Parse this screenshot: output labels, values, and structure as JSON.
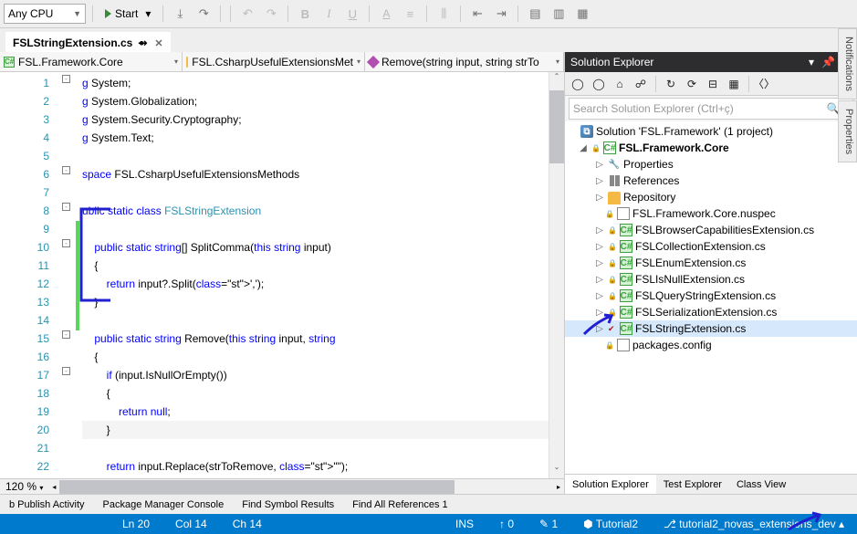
{
  "toolbar": {
    "platform": "Any CPU",
    "start": "Start"
  },
  "tab": {
    "filename": "FSLStringExtension.cs",
    "pin": "⊕"
  },
  "nav": {
    "ns": "FSL.Framework.Core",
    "cls": "FSL.CsharpUsefulExtensionsMet",
    "method": "Remove(string input, string strTo"
  },
  "code": {
    "lines": [
      {
        "n": "1",
        "t": "g System;"
      },
      {
        "n": "2",
        "t": "g System.Globalization;"
      },
      {
        "n": "3",
        "t": "g System.Security.Cryptography;"
      },
      {
        "n": "4",
        "t": "g System.Text;"
      },
      {
        "n": "5",
        "t": ""
      },
      {
        "n": "6",
        "t": "space FSL.CsharpUsefulExtensionsMethods"
      },
      {
        "n": "7",
        "t": ""
      },
      {
        "n": "8",
        "t": "ublic static class FSLStringExtension",
        "kw": "ublic static class",
        "tp": "FSLStringExtension"
      },
      {
        "n": "9",
        "t": ""
      },
      {
        "n": "10",
        "t": "    public static string[] SplitComma(this string input)"
      },
      {
        "n": "11",
        "t": "    {"
      },
      {
        "n": "12",
        "t": "        return input?.Split(',');"
      },
      {
        "n": "13",
        "t": "    }"
      },
      {
        "n": "14",
        "t": ""
      },
      {
        "n": "15",
        "t": "    public static string Remove(this string input, string"
      },
      {
        "n": "16",
        "t": "    {"
      },
      {
        "n": "17",
        "t": "        if (input.IsNullOrEmpty())"
      },
      {
        "n": "18",
        "t": "        {"
      },
      {
        "n": "19",
        "t": "            return null;"
      },
      {
        "n": "20",
        "t": "        }",
        "hl": true
      },
      {
        "n": "21",
        "t": ""
      },
      {
        "n": "22",
        "t": "        return input.Replace(strToRemove, \"\");"
      }
    ]
  },
  "zoom": "120 %",
  "solx": {
    "title": "Solution Explorer",
    "search_placeholder": "Search Solution Explorer (Ctrl+ç)",
    "solution": "Solution 'FSL.Framework' (1 project)",
    "project": "FSL.Framework.Core",
    "items": {
      "properties": "Properties",
      "references": "References",
      "repository": "Repository",
      "nuspec": "FSL.Framework.Core.nuspec",
      "files": [
        "FSLBrowserCapabilitiesExtension.cs",
        "FSLCollectionExtension.cs",
        "FSLEnumExtension.cs",
        "FSLIsNullExtension.cs",
        "FSLQueryStringExtension.cs",
        "FSLSerializationExtension.cs",
        "FSLStringExtension.cs"
      ],
      "packages": "packages.config"
    },
    "tabs": [
      "Solution Explorer",
      "Test Explorer",
      "Class View"
    ]
  },
  "vside": [
    "Notifications",
    "Properties"
  ],
  "outtabs": [
    "b Publish Activity",
    "Package Manager Console",
    "Find Symbol Results",
    "Find All References 1"
  ],
  "status": {
    "ln": "Ln 20",
    "col": "Col 14",
    "ch": "Ch 14",
    "mode": "INS",
    "up": "0",
    "pen": "1",
    "branch_repo": "Tutorial2",
    "branch": "tutorial2_novas_extensions_dev"
  }
}
